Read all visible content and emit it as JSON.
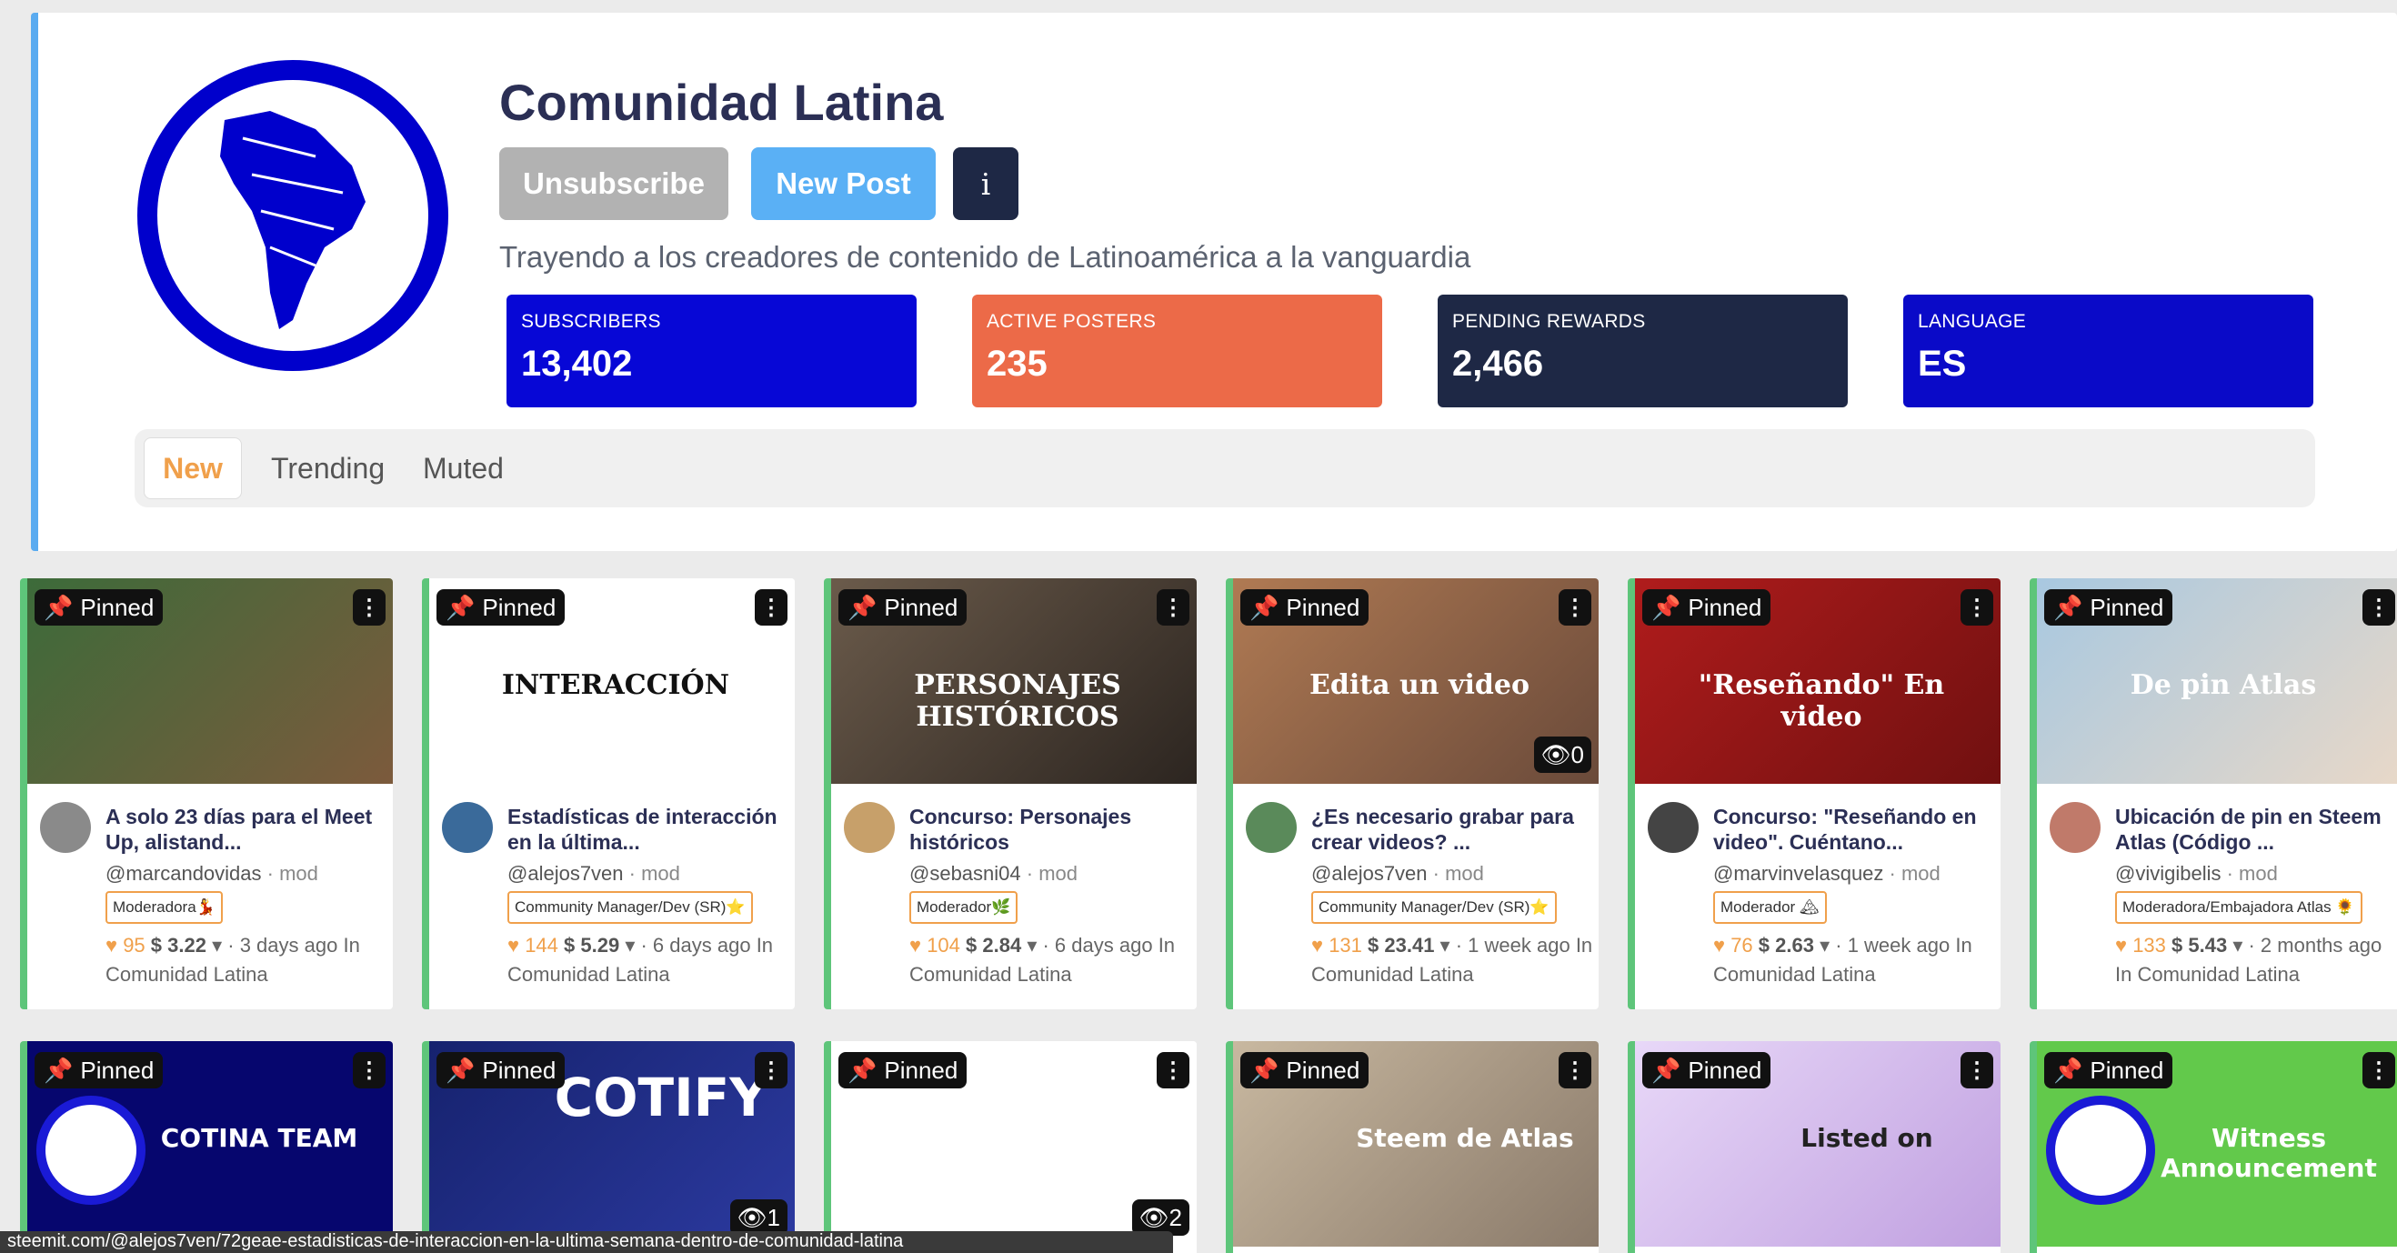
{
  "community": {
    "title": "Comunidad Latina",
    "unsubscribe_label": "Unsubscribe",
    "new_post_label": "New Post",
    "info_label": "i",
    "description": "Trayendo a los creadores de contenido de Latinoamérica a la vanguardia",
    "accent_color": "#0000cc"
  },
  "stats": [
    {
      "label": "SUBSCRIBERS",
      "value": "13,402",
      "color": "#0707d6"
    },
    {
      "label": "ACTIVE POSTERS",
      "value": "235",
      "color": "#ec6a48"
    },
    {
      "label": "PENDING REWARDS",
      "value": "2,466",
      "color": "#1e2845"
    },
    {
      "label": "LANGUAGE",
      "value": "ES",
      "color": "#0a0ac8"
    }
  ],
  "tabs": [
    "New",
    "Trending",
    "Muted"
  ],
  "pinned_label": "Pinned",
  "posts": [
    {
      "title": "A solo 23 días para el Meet Up, alistand...",
      "author": "@marcandovidas",
      "role": "mod",
      "badge": "Moderadora💃",
      "votes": "95",
      "payout": "$ 3.22",
      "time": "3 days ago",
      "community": "In Comunidad Latina",
      "thumb_text": "",
      "views": ""
    },
    {
      "title": "Estadísticas de interacción en la última...",
      "author": "@alejos7ven",
      "role": "mod",
      "badge": "Community Manager/Dev (SR)⭐",
      "votes": "144",
      "payout": "$ 5.29",
      "time": "6 days ago",
      "community": "In Comunidad Latina",
      "thumb_text": "INTERACCIÓN",
      "views": ""
    },
    {
      "title": "Concurso: Personajes históricos",
      "author": "@sebasni04",
      "role": "mod",
      "badge": "Moderador🌿",
      "votes": "104",
      "payout": "$ 2.84",
      "time": "6 days ago",
      "community": "In Comunidad Latina",
      "thumb_text": "PERSONAJES HISTÓRICOS",
      "views": ""
    },
    {
      "title": "¿Es necesario grabar para crear videos? ...",
      "author": "@alejos7ven",
      "role": "mod",
      "badge": "Community Manager/Dev (SR)⭐",
      "votes": "131",
      "payout": "$ 23.41",
      "time": "1 week ago",
      "community": "In Comunidad Latina",
      "thumb_text": "Edita un video",
      "views": "0"
    },
    {
      "title": "Concurso: \"Reseñando en video\". Cuéntano...",
      "author": "@marvinvelasquez",
      "role": "mod",
      "badge": "Moderador 🏔",
      "votes": "76",
      "payout": "$ 2.63",
      "time": "1 week ago",
      "community": "In Comunidad Latina",
      "thumb_text": "\"Reseñando\" En video",
      "views": ""
    },
    {
      "title": "Ubicación de pin en Steem Atlas (Código ...",
      "author": "@vivigibelis",
      "role": "mod",
      "badge": "Moderadora/Embajadora Atlas 🌻",
      "votes": "133",
      "payout": "$ 5.43",
      "time": "2 months ago",
      "community": "In Comunidad Latina",
      "thumb_text": "De pin Atlas",
      "views": ""
    }
  ],
  "row2": [
    {
      "thumb_text": "COTINA TEAM",
      "views": ""
    },
    {
      "thumb_text": "COTIFY",
      "views": "1"
    },
    {
      "thumb_text": "",
      "views": "2"
    },
    {
      "thumb_text": "Steem de Atlas",
      "views": ""
    },
    {
      "thumb_text": "Listed on",
      "views": ""
    },
    {
      "thumb_text": "Witness Announcement",
      "views": ""
    }
  ],
  "statusbar": "steemit.com/@alejos7ven/72geae-estadisticas-de-interaccion-en-la-ultima-semana-dentro-de-comunidad-latina"
}
